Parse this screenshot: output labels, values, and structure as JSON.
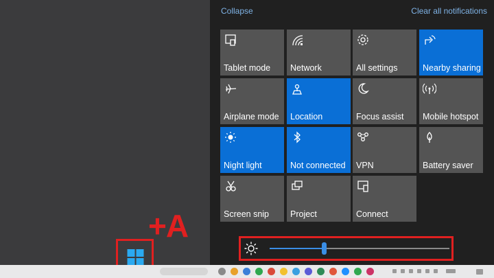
{
  "action_center": {
    "collapse_label": "Collapse",
    "clear_label": "Clear all notifications",
    "tiles": [
      {
        "label": "Tablet mode",
        "icon": "tablet-mode-icon",
        "active": false
      },
      {
        "label": "Network",
        "icon": "network-icon",
        "active": false
      },
      {
        "label": "All settings",
        "icon": "gear-icon",
        "active": false
      },
      {
        "label": "Nearby sharing",
        "icon": "nearby-sharing-icon",
        "active": true
      },
      {
        "label": "Airplane mode",
        "icon": "airplane-icon",
        "active": false
      },
      {
        "label": "Location",
        "icon": "location-icon",
        "active": true
      },
      {
        "label": "Focus assist",
        "icon": "moon-icon",
        "active": false
      },
      {
        "label": "Mobile hotspot",
        "icon": "hotspot-icon",
        "active": false
      },
      {
        "label": "Night light",
        "icon": "sun-icon",
        "active": true
      },
      {
        "label": "Not connected",
        "icon": "bluetooth-icon",
        "active": true
      },
      {
        "label": "VPN",
        "icon": "vpn-icon",
        "active": false
      },
      {
        "label": "Battery saver",
        "icon": "battery-saver-icon",
        "active": false
      },
      {
        "label": "Screen snip",
        "icon": "screen-snip-icon",
        "active": false
      },
      {
        "label": "Project",
        "icon": "project-icon",
        "active": false
      },
      {
        "label": "Connect",
        "icon": "connect-icon",
        "active": false
      }
    ]
  },
  "brightness": {
    "level_fraction": 0.3,
    "icon": "brightness-sun-icon"
  },
  "shortcut": {
    "text": "+A",
    "icon": "windows-logo-icon"
  },
  "colors": {
    "active_tile": "#0a6fd6",
    "inactive_tile": "#545454",
    "panel": "#202020",
    "highlight": "#e02020",
    "link": "#7fb3e6"
  }
}
